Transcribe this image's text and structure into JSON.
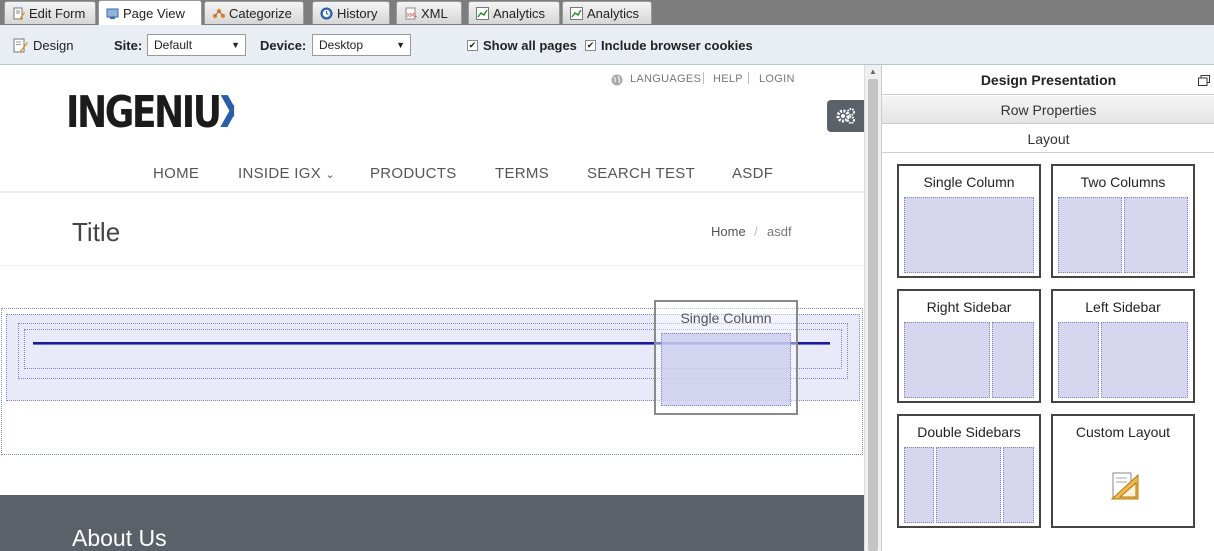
{
  "tabs": [
    {
      "label": "Edit Form",
      "icon": "edit-form-icon"
    },
    {
      "label": "Page View",
      "icon": "page-view-icon",
      "active": true
    },
    {
      "label": "Categorize",
      "icon": "categorize-icon"
    },
    {
      "label": "History",
      "icon": "history-icon"
    },
    {
      "label": "XML",
      "icon": "xml-icon"
    },
    {
      "label": "Analytics",
      "icon": "analytics-icon"
    },
    {
      "label": "Analytics",
      "icon": "analytics-icon"
    }
  ],
  "toolbar": {
    "design_label": "Design",
    "site_label": "Site:",
    "site_value": "Default",
    "device_label": "Device:",
    "device_value": "Desktop",
    "show_all_pages": "Show all pages",
    "include_cookies": "Include browser cookies"
  },
  "site": {
    "utility": {
      "languages": "LANGUAGES",
      "help": "HELP",
      "login": "LOGIN"
    },
    "logo_text": "INGENIUX",
    "nav": [
      "HOME",
      "INSIDE IGX",
      "PRODUCTS",
      "TERMS",
      "SEARCH TEST",
      "ASDF"
    ],
    "nav_dropdown_marker": "⌄",
    "page_title": "Title",
    "breadcrumb": {
      "home": "Home",
      "separator": "/",
      "current": "asdf"
    },
    "drag_ghost_label": "Single Column",
    "footer_heading": "About Us"
  },
  "panel": {
    "title": "Design Presentation",
    "row_properties": "Row Properties",
    "layout": "Layout",
    "layouts": [
      "Single Column",
      "Two Columns",
      "Right Sidebar",
      "Left Sidebar",
      "Double Sidebars",
      "Custom Layout"
    ]
  },
  "colors": {
    "accent_blue": "#2a5ea8",
    "footer_bg": "#5b6169",
    "drop_zone": "#d6d7ee",
    "toolbar_bg": "#e8eef4"
  }
}
